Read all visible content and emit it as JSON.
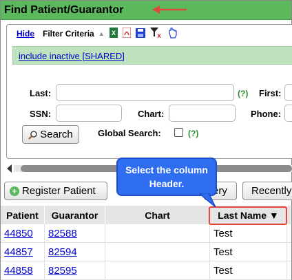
{
  "window": {
    "title": "Find Patient/Guarantor"
  },
  "filter": {
    "hide_label": "Hide",
    "title": "Filter Criteria",
    "shared_link": "include inactive [SHARED]",
    "toolbar_icons": [
      "excel-icon",
      "pdf-icon",
      "save-icon",
      "clear-filter-icon",
      "pointer-hand-icon"
    ]
  },
  "form": {
    "last_label": "Last:",
    "last_help": "(?)",
    "first_label": "First:",
    "ssn_label": "SSN:",
    "chart_label": "Chart:",
    "phone_label": "Phone:",
    "search_button": "Search",
    "global_search_label": "Global Search:",
    "global_help": "(?)"
  },
  "actions": {
    "register_patient": "Register Patient",
    "query_partial": "ery",
    "recently_partial": "Recently"
  },
  "callout": {
    "text": "Select the column Header."
  },
  "table": {
    "columns": [
      "Patient",
      "Guarantor",
      "Chart",
      "Last Name ▼"
    ],
    "rows": [
      {
        "patient": "44850",
        "guarantor": "82588",
        "chart": "",
        "last_name": "Test"
      },
      {
        "patient": "44857",
        "guarantor": "82594",
        "chart": "",
        "last_name": "Test"
      },
      {
        "patient": "44858",
        "guarantor": "82595",
        "chart": "",
        "last_name": "Test"
      }
    ]
  },
  "colors": {
    "title_bar": "#5cb85c",
    "shared_bar": "#bfe3bf",
    "callout": "#2f6ef0",
    "highlight": "#e0483c",
    "link": "#0000cc"
  }
}
